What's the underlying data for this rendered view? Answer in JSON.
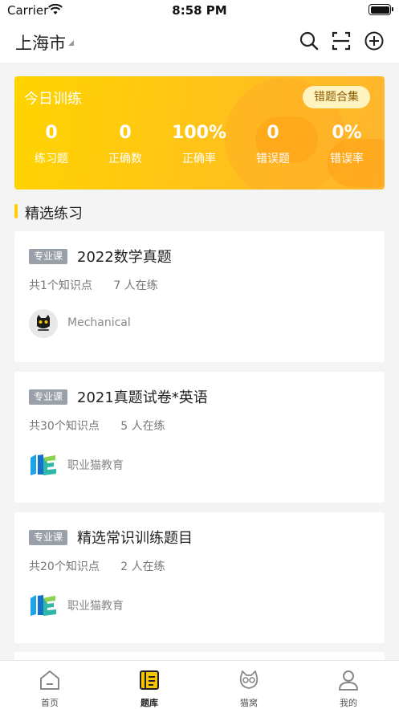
{
  "status_bar": {
    "carrier": "Carrier",
    "time": "8:58 PM"
  },
  "header": {
    "city": "上海市",
    "icons": [
      "search-icon",
      "scan-icon",
      "add-circle-icon"
    ]
  },
  "training": {
    "title": "今日训练",
    "wrong_collection_button": "错题合集",
    "stats": [
      {
        "value": "0",
        "label": "练习题"
      },
      {
        "value": "0",
        "label": "正确数"
      },
      {
        "value": "100%",
        "label": "正确率"
      },
      {
        "value": "0",
        "label": "错误题"
      },
      {
        "value": "0%",
        "label": "错误率"
      }
    ],
    "colors": {
      "accent": "#ffc21a"
    }
  },
  "section": {
    "title": "精选练习"
  },
  "courses": [
    {
      "tag": "专业课",
      "title": "2022数学真题",
      "knowledge_points": "共1个知识点",
      "learners": "7 人在练",
      "author": "Mechanical",
      "avatar_icon": "cat-avatar-icon"
    },
    {
      "tag": "专业课",
      "title": "2021真题试卷*英语",
      "knowledge_points": "共30个知识点",
      "learners": "5 人在练",
      "author": "职业猫教育",
      "avatar_icon": "brand-logo-icon"
    },
    {
      "tag": "专业课",
      "title": "精选常识训练题目",
      "knowledge_points": "共20个知识点",
      "learners": "2 人在练",
      "author": "职业猫教育",
      "avatar_icon": "brand-logo-icon"
    }
  ],
  "tabbar": {
    "items": [
      {
        "label": "首页",
        "icon": "home-icon",
        "active": false
      },
      {
        "label": "题库",
        "icon": "question-bank-icon",
        "active": true
      },
      {
        "label": "猫窝",
        "icon": "cat-icon",
        "active": false
      },
      {
        "label": "我的",
        "icon": "user-icon",
        "active": false
      }
    ]
  }
}
